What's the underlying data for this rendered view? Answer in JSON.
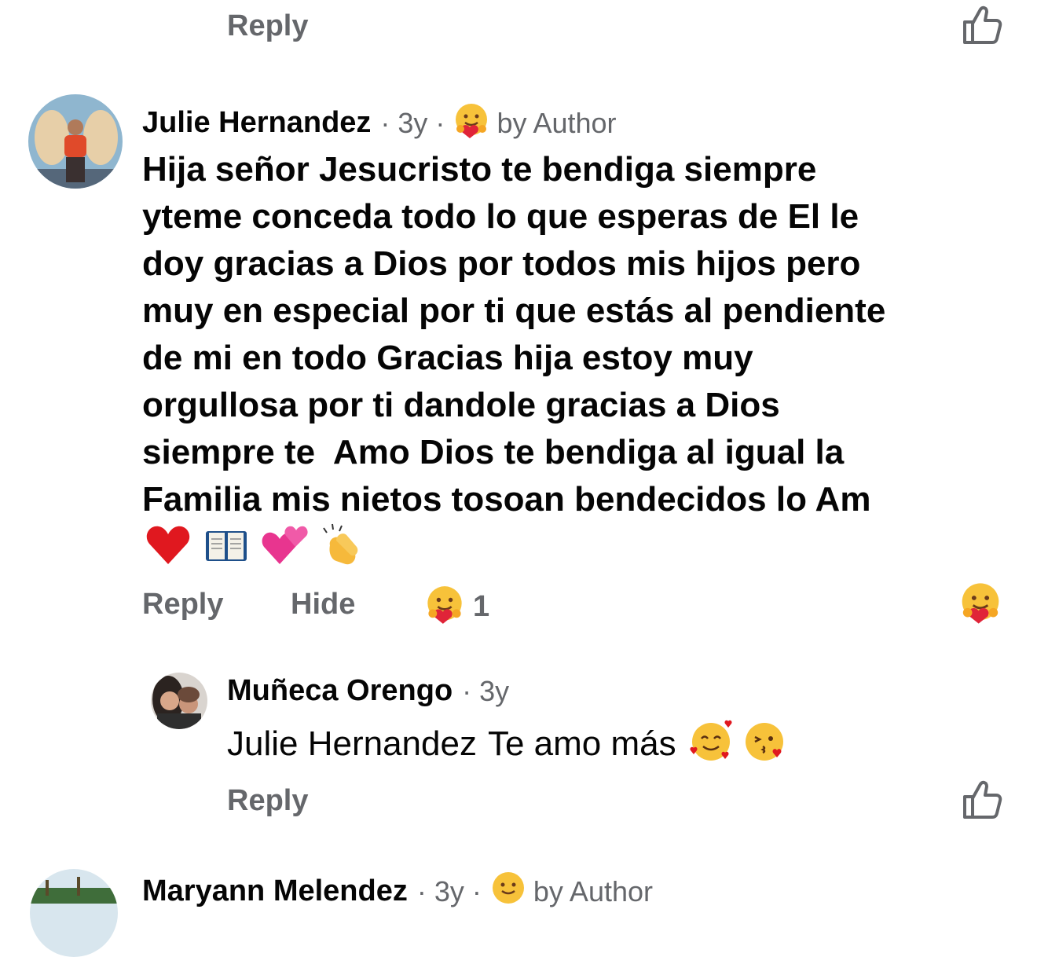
{
  "top_reply": {
    "reply_label": "Reply"
  },
  "comment_main": {
    "author": "Julie Hernandez",
    "time": "· 3y ·",
    "reacted_by": "by Author",
    "text_lines": [
      "Hija señor Jesucristo te bendiga siempre",
      "yteme conceda todo lo que esperas de El le",
      "doy gracias a Dios por todos mis hijos pero",
      "muy en especial por ti que estás al pendiente",
      "de mi en todo Gracias hija estoy muy",
      "orgullosa por ti dandole gracias a Dios",
      "siempre te  Amo Dios te bendiga al igual la",
      "Familia mis nietos tosoan bendecidos lo Am"
    ],
    "emojis": [
      "red-heart",
      "open-book",
      "revolving-hearts",
      "clapping-hands"
    ],
    "actions": {
      "reply_label": "Reply",
      "hide_label": "Hide",
      "reaction_count": "1"
    }
  },
  "reply_comment": {
    "author": "Muñeca Orengo",
    "time": "· 3y",
    "mention": "Julie Hernandez",
    "text": "Te amo más",
    "emojis": [
      "smiling-face-with-hearts",
      "face-blowing-kiss"
    ],
    "reply_label": "Reply"
  },
  "next_comment": {
    "author": "Maryann Melendez",
    "time": "· 3y ·",
    "reacted_by": "by Author"
  },
  "colors": {
    "name": "#050505",
    "meta": "#65676b",
    "mention": "#1d63c9"
  }
}
